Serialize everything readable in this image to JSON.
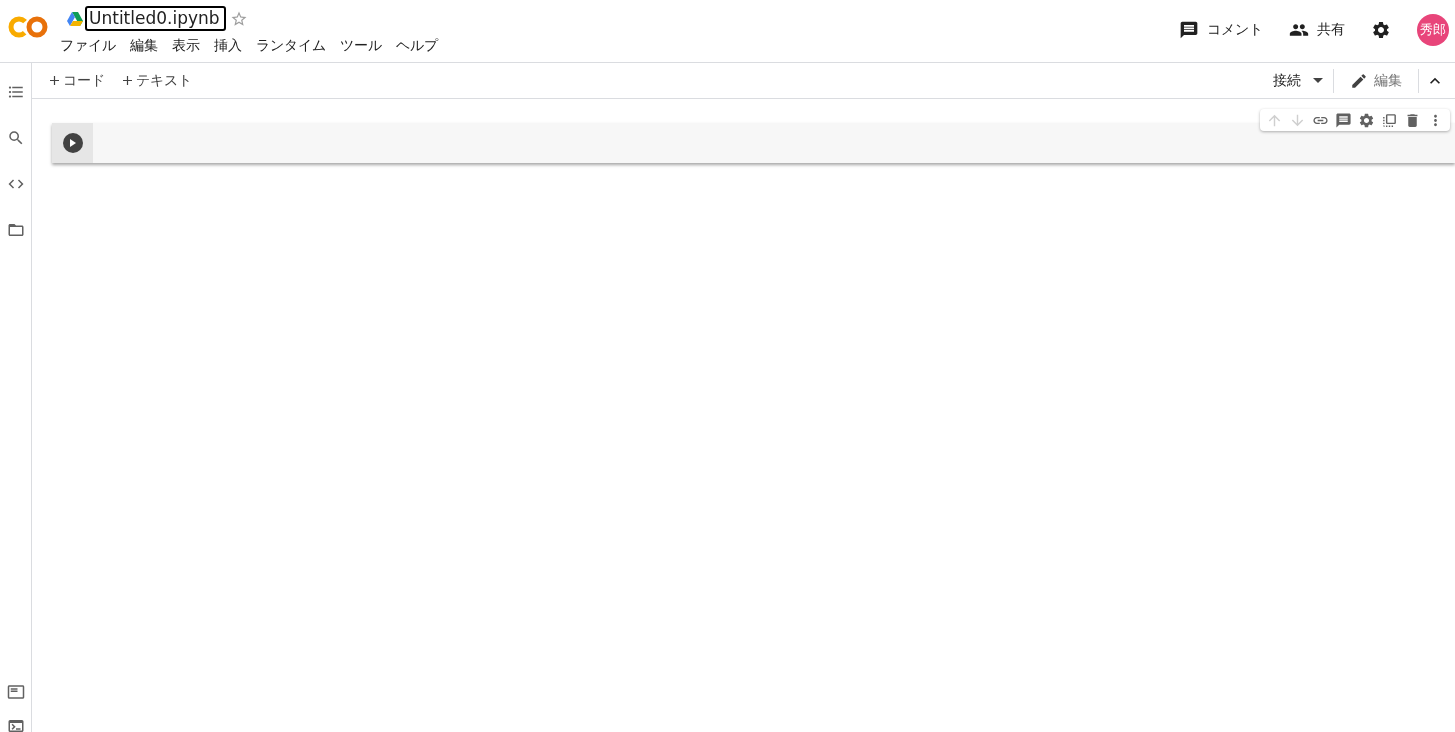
{
  "notebook": {
    "title": "Untitled0.ipynb",
    "starred": false
  },
  "menu": [
    "ファイル",
    "編集",
    "表示",
    "挿入",
    "ランタイム",
    "ツール",
    "ヘルプ"
  ],
  "header_actions": [
    {
      "kind": "comment",
      "label": "コメント"
    },
    {
      "kind": "share",
      "label": "共有"
    },
    {
      "kind": "settings"
    }
  ],
  "avatar": {
    "initials": "秀郎",
    "color": "#e8457a"
  },
  "toolbar": {
    "add_buttons": [
      "コード",
      "テキスト"
    ],
    "connect": "接続",
    "edit": "編集"
  },
  "cell_toolbar": [
    {
      "kind": "up",
      "disabled": true
    },
    {
      "kind": "down",
      "disabled": true
    },
    {
      "kind": "link",
      "disabled": false
    },
    {
      "kind": "comment",
      "disabled": false
    },
    {
      "kind": "settings",
      "disabled": false
    },
    {
      "kind": "mirror",
      "disabled": false
    },
    {
      "kind": "delete",
      "disabled": false
    },
    {
      "kind": "more",
      "disabled": false
    }
  ],
  "sidebar": [
    {
      "kind": "toc"
    },
    {
      "kind": "search"
    },
    {
      "kind": "code"
    },
    {
      "kind": "files"
    }
  ],
  "sidebar_bottom": [
    {
      "kind": "snippets"
    },
    {
      "kind": "terminal"
    }
  ]
}
